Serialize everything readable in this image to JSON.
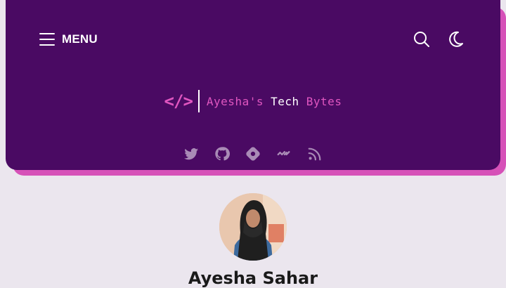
{
  "header": {
    "menu_label": "MENU",
    "logo": {
      "code_glyph": "</>",
      "name_part1": "Ayesha's",
      "name_part2": "Tech",
      "name_part3": "Bytes"
    },
    "socials": [
      {
        "name": "twitter-icon"
      },
      {
        "name": "github-icon"
      },
      {
        "name": "hashnode-icon"
      },
      {
        "name": "devto-icon"
      },
      {
        "name": "rss-icon"
      }
    ]
  },
  "author": {
    "name": "Ayesha Sahar"
  },
  "colors": {
    "header_bg": "#4a0a63",
    "accent_pink": "#e056c0",
    "page_bg": "#ebe6ee"
  }
}
